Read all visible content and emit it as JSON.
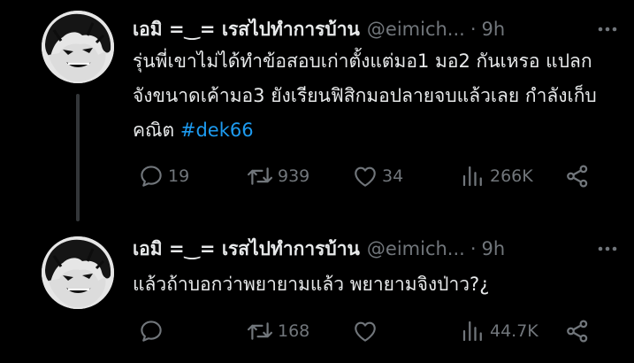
{
  "tweets": [
    {
      "display_name": "เอมิ =‿= เรสไปทำการบ้าน",
      "handle": "@eimich...",
      "dot": "·",
      "time": "9h",
      "text": "รุ่นพี่เขาไม่ได้ทำข้อสอบเก่าตั้งแต่มอ1 มอ2 กันเหรอ แปลกจังขนาดเค้ามอ3 ยังเรียนฟิสิกมอปลายจบแล้วเลย กำลังเก็บคณิต ",
      "hashtag": "#dek66",
      "replies": "19",
      "retweets": "939",
      "likes": "34",
      "views": "266K",
      "icons": [
        "avatar",
        "more-icon",
        "reply-icon",
        "retweet-icon",
        "like-icon",
        "views-icon",
        "share-icon"
      ]
    },
    {
      "display_name": "เอมิ =‿= เรสไปทำการบ้าน",
      "handle": "@eimich...",
      "dot": "·",
      "time": "9h",
      "text": "แล้วถ้าบอกว่าพยายามแล้ว พยายามจิงป่าว?¿",
      "replies": "",
      "retweets": "168",
      "likes": "",
      "views": "44.7K",
      "icons": [
        "avatar",
        "more-icon",
        "reply-icon",
        "retweet-icon",
        "like-icon",
        "views-icon",
        "share-icon"
      ]
    }
  ],
  "colors": {
    "background": "#000000",
    "text_primary": "#e7e9ea",
    "text_secondary": "#71767b",
    "hashtag": "#1d9bf0",
    "thread_line": "#333639"
  }
}
